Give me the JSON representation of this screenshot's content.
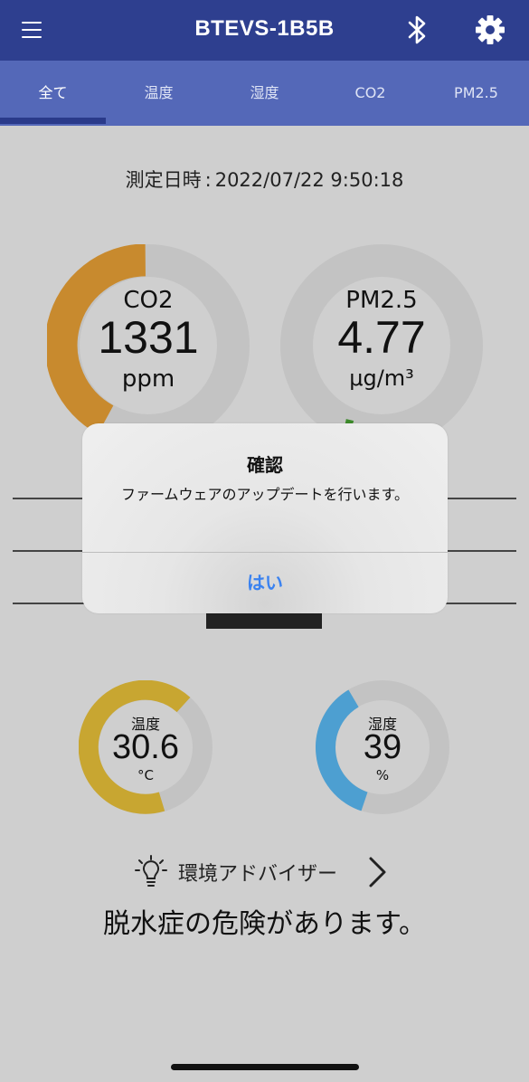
{
  "header": {
    "title": "BTEVS-1B5B"
  },
  "tabs": [
    {
      "label": "全て"
    },
    {
      "label": "温度"
    },
    {
      "label": "湿度"
    },
    {
      "label": "CO2"
    },
    {
      "label": "PM2.5"
    }
  ],
  "measurement": {
    "label": "測定日時",
    "separator": ":",
    "datetime": "2022/07/22 9:50:18"
  },
  "gauges": {
    "co2": {
      "name": "CO2",
      "value": "1331",
      "unit": "ppm",
      "color": "#c88a2e"
    },
    "pm25": {
      "name": "PM2.5",
      "value": "4.77",
      "unit": "μg/m³",
      "color": "#3c8a2a"
    },
    "temperature": {
      "name": "温度",
      "value": "30.6",
      "unit": "°C",
      "color": "#c8a631"
    },
    "humidity": {
      "name": "湿度",
      "value": "39",
      "unit": "%",
      "color": "#4d9fd1"
    }
  },
  "advisor": {
    "label": "環境アドバイザー",
    "message": "脱水症の危険があります。"
  },
  "dialog": {
    "title": "確認",
    "message": "ファームウェアのアップデートを行います。",
    "button": "はい"
  },
  "icons": [
    "hamburger-icon",
    "bluetooth-icon",
    "gear-icon",
    "lightbulb-icon",
    "chevron-right-icon"
  ]
}
